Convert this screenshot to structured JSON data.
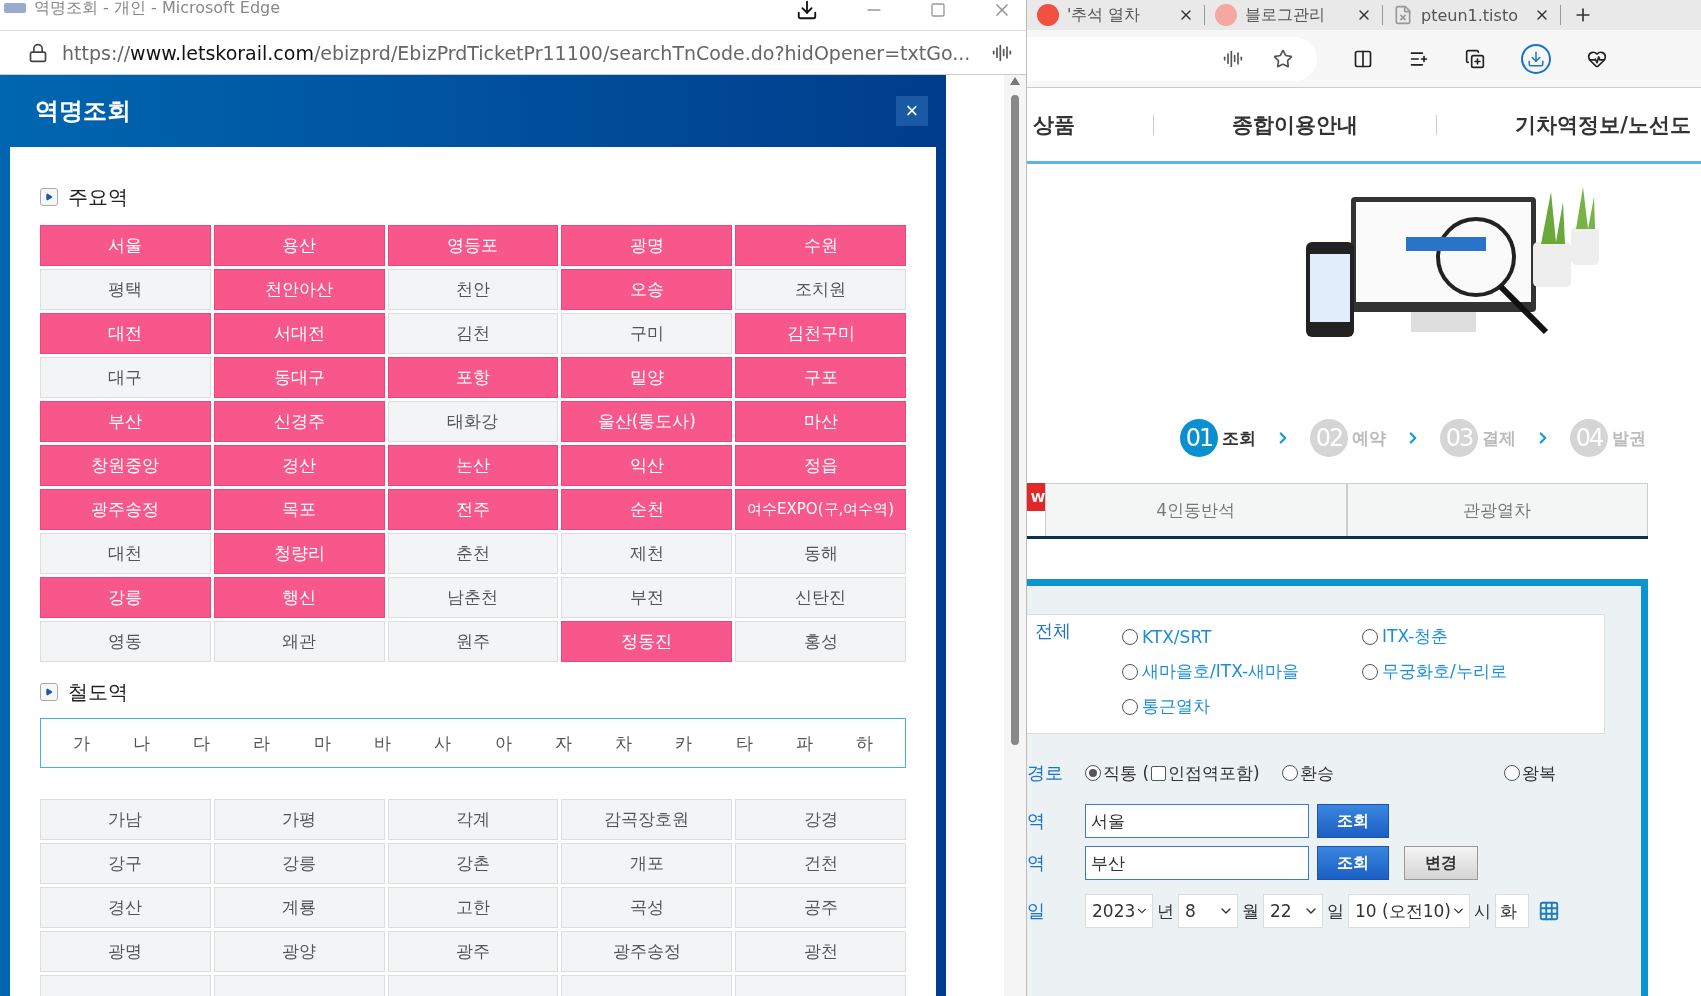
{
  "popup_window": {
    "title": "역명조회 - 개인 - Microsoft Edge",
    "url": "https://**www.letskorail.com**/ebizprd/EbizPrdTicketPr11100/searchTnCode.do?hidOpener=txtGo..."
  },
  "dialog": {
    "title": "역명조회",
    "close": "×"
  },
  "major_stations": {
    "heading": "주요역",
    "stations": [
      {
        "name": "서울",
        "highlighted": true
      },
      {
        "name": "용산",
        "highlighted": true
      },
      {
        "name": "영등포",
        "highlighted": true
      },
      {
        "name": "광명",
        "highlighted": true
      },
      {
        "name": "수원",
        "highlighted": true
      },
      {
        "name": "평택",
        "highlighted": false
      },
      {
        "name": "천안아산",
        "highlighted": true
      },
      {
        "name": "천안",
        "highlighted": false
      },
      {
        "name": "오송",
        "highlighted": true
      },
      {
        "name": "조치원",
        "highlighted": false
      },
      {
        "name": "대전",
        "highlighted": true
      },
      {
        "name": "서대전",
        "highlighted": true
      },
      {
        "name": "김천",
        "highlighted": false
      },
      {
        "name": "구미",
        "highlighted": false
      },
      {
        "name": "김천구미",
        "highlighted": true
      },
      {
        "name": "대구",
        "highlighted": false
      },
      {
        "name": "동대구",
        "highlighted": true
      },
      {
        "name": "포항",
        "highlighted": true
      },
      {
        "name": "밀양",
        "highlighted": true
      },
      {
        "name": "구포",
        "highlighted": true
      },
      {
        "name": "부산",
        "highlighted": true
      },
      {
        "name": "신경주",
        "highlighted": true
      },
      {
        "name": "태화강",
        "highlighted": false
      },
      {
        "name": "울산(통도사)",
        "highlighted": true
      },
      {
        "name": "마산",
        "highlighted": true
      },
      {
        "name": "창원중앙",
        "highlighted": true
      },
      {
        "name": "경산",
        "highlighted": true
      },
      {
        "name": "논산",
        "highlighted": true
      },
      {
        "name": "익산",
        "highlighted": true
      },
      {
        "name": "정읍",
        "highlighted": true
      },
      {
        "name": "광주송정",
        "highlighted": true
      },
      {
        "name": "목포",
        "highlighted": true
      },
      {
        "name": "전주",
        "highlighted": true
      },
      {
        "name": "순천",
        "highlighted": true
      },
      {
        "name": "여수EXPO(구,여수역)",
        "highlighted": true
      },
      {
        "name": "대천",
        "highlighted": false
      },
      {
        "name": "청량리",
        "highlighted": true
      },
      {
        "name": "춘천",
        "highlighted": false
      },
      {
        "name": "제천",
        "highlighted": false
      },
      {
        "name": "동해",
        "highlighted": false
      },
      {
        "name": "강릉",
        "highlighted": true
      },
      {
        "name": "행신",
        "highlighted": true
      },
      {
        "name": "남춘천",
        "highlighted": false
      },
      {
        "name": "부전",
        "highlighted": false
      },
      {
        "name": "신탄진",
        "highlighted": false
      },
      {
        "name": "영동",
        "highlighted": false
      },
      {
        "name": "왜관",
        "highlighted": false
      },
      {
        "name": "원주",
        "highlighted": false
      },
      {
        "name": "정동진",
        "highlighted": true
      },
      {
        "name": "홍성",
        "highlighted": false
      }
    ]
  },
  "railway_stations": {
    "heading": "철도역",
    "initials": [
      "가",
      "나",
      "다",
      "라",
      "마",
      "바",
      "사",
      "아",
      "자",
      "차",
      "카",
      "타",
      "파",
      "하"
    ],
    "stations": [
      "가남",
      "가평",
      "각계",
      "감곡장호원",
      "강경",
      "강구",
      "강릉",
      "강촌",
      "개포",
      "건천",
      "경산",
      "계룡",
      "고한",
      "곡성",
      "공주",
      "광명",
      "광양",
      "광주",
      "광주송정",
      "광천"
    ]
  },
  "browser": {
    "tabs": [
      "'추석 열차",
      "블로그관리",
      "pteun1.tisto"
    ]
  },
  "nav": [
    "상품",
    "종합이용안내",
    "기차역정보/노선도"
  ],
  "steps": [
    {
      "number": "01",
      "label": "조회",
      "selected": true
    },
    {
      "number": "02",
      "label": "예약",
      "selected": false
    },
    {
      "number": "03",
      "label": "결제",
      "selected": false
    },
    {
      "number": "04",
      "label": "발권",
      "selected": false
    }
  ],
  "service_tabs": {
    "badge": "W",
    "items": [
      "4인동반석",
      "관광열차"
    ]
  },
  "train_types": {
    "label": "전체",
    "options": [
      {
        "label": "KTX/SRT",
        "selected": false
      },
      {
        "label": "ITX-청춘",
        "selected": false
      },
      {
        "label": "새마을호/ITX-새마을",
        "selected": false
      },
      {
        "label": "무궁화호/누리로",
        "selected": false
      },
      {
        "label": "통근열차",
        "selected": false
      }
    ]
  },
  "route": {
    "label": "경로",
    "items": [
      {
        "kind": "radio",
        "label": "직통 (",
        "selected": true
      },
      {
        "kind": "checkbox",
        "label": "인접역포함)",
        "checked": false
      },
      {
        "kind": "radio",
        "label": "환승",
        "selected": false
      },
      {
        "kind": "radio",
        "label": "왕복",
        "selected": false
      }
    ]
  },
  "departure": {
    "label": "역",
    "value": "서울",
    "button": "조회"
  },
  "arrival": {
    "label": "역",
    "value": "부산",
    "button": "조회",
    "swap_button": "변경"
  },
  "date": {
    "label": "일",
    "year": "2023",
    "year_unit": "년",
    "month": "8",
    "month_unit": "월",
    "day": "22",
    "day_unit": "일",
    "hour": "10 (오전10)",
    "hour_unit": "시",
    "weekday": "화"
  }
}
